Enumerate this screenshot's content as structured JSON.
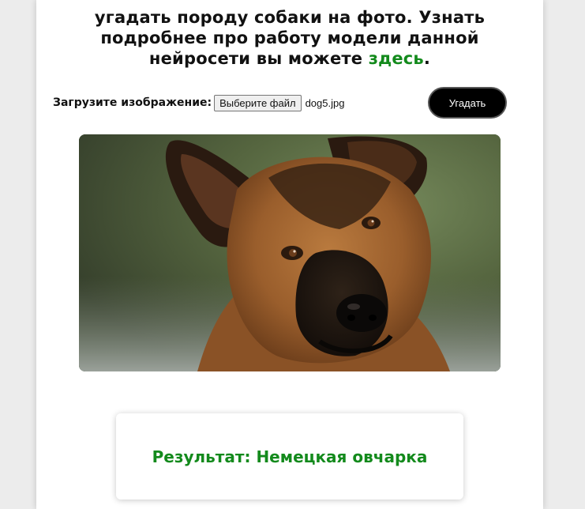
{
  "intro": {
    "line1": "угадать породу собаки на фото. Узнать",
    "line2": "подробнее про работу модели данной",
    "line3_prefix": "нейросети вы можете ",
    "link_text": "здесь",
    "line3_suffix": "."
  },
  "upload": {
    "label": "Загрузите изображение:",
    "file_button": "Выберите файл",
    "file_name": "dog5.jpg"
  },
  "guess_button": "Угадать",
  "photo": {
    "subject": "german-shepherd-dog-photo"
  },
  "result": {
    "text": "Результат: Немецкая овчарка"
  },
  "colors": {
    "accent_green": "#138a1c",
    "button_black": "#000000"
  }
}
